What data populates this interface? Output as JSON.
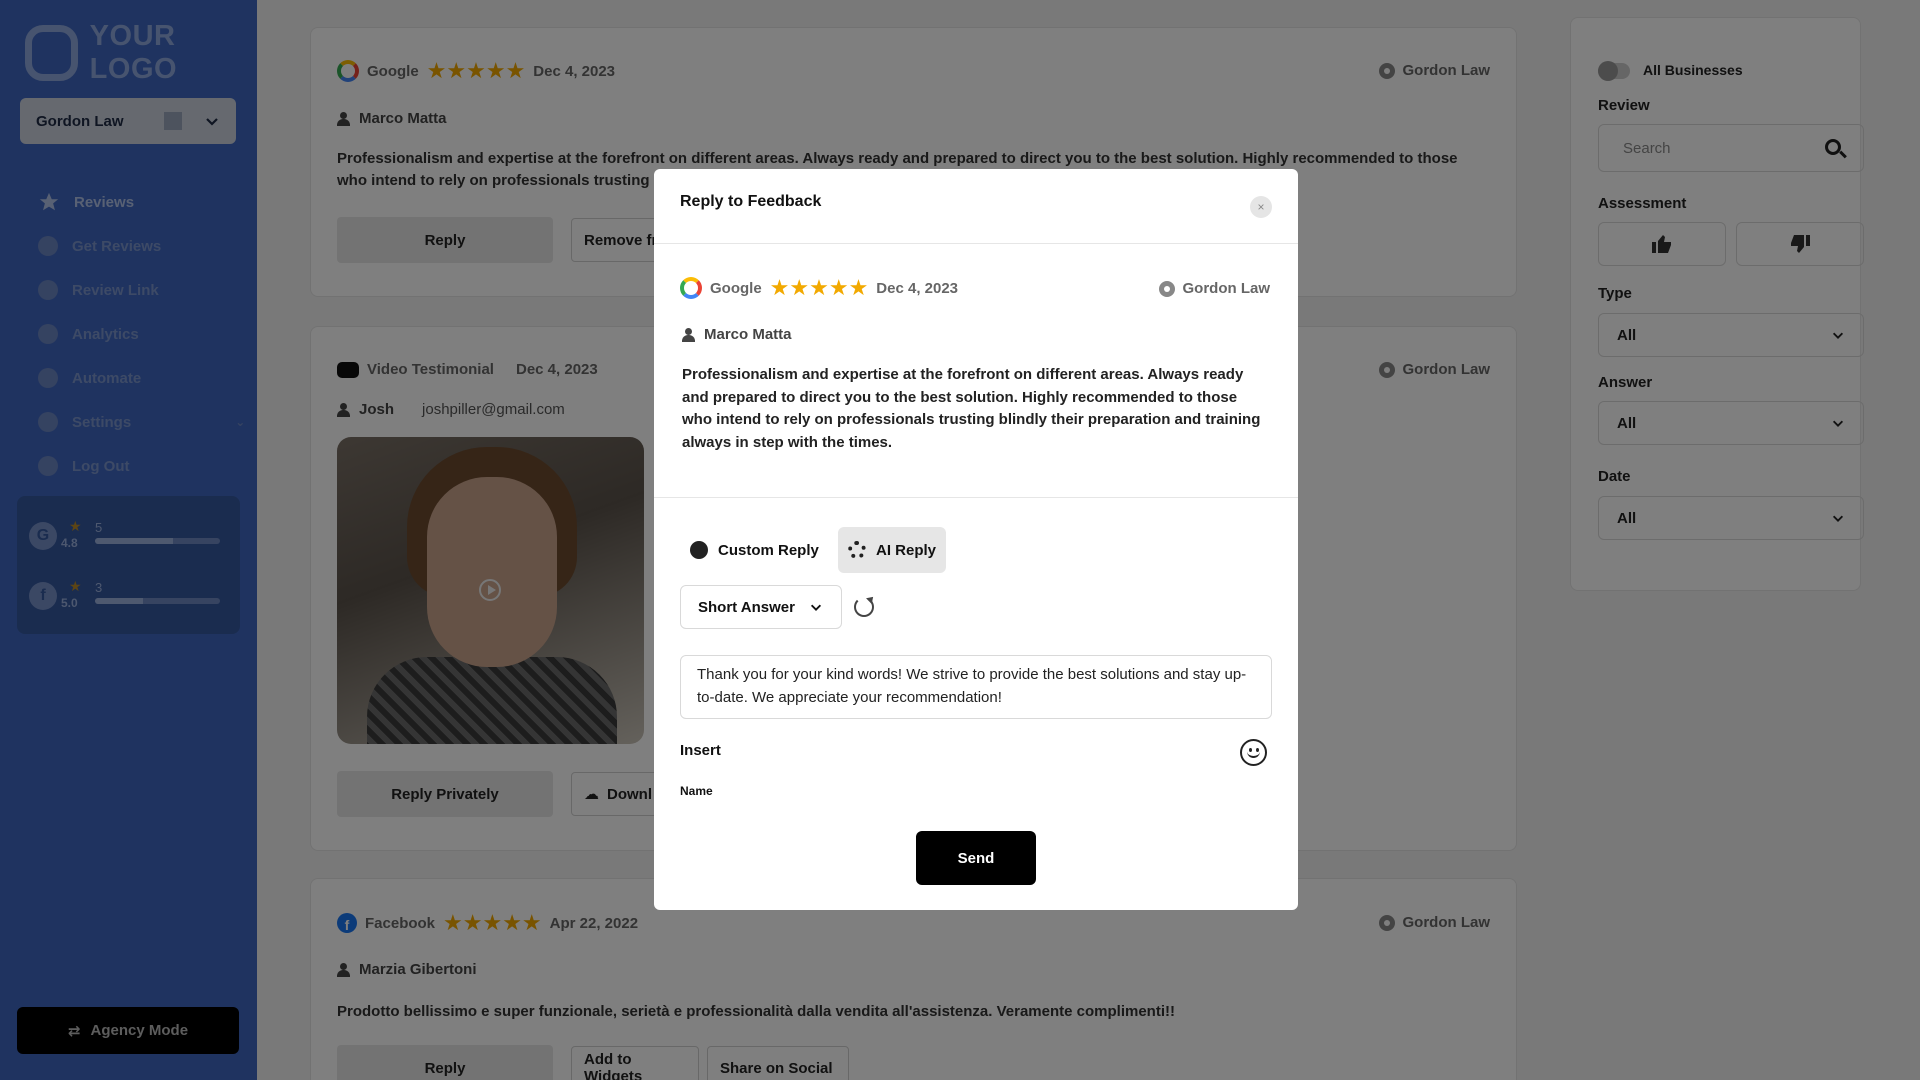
{
  "sidebar": {
    "logo_text": "YOUR LOGO",
    "business": "Gordon Law",
    "nav": [
      {
        "label": "Reviews",
        "icon": "star-icon"
      },
      {
        "label": "Get Reviews",
        "icon": "plus-icon"
      },
      {
        "label": "Review Link",
        "icon": "link-icon"
      },
      {
        "label": "Analytics",
        "icon": "chart-icon"
      },
      {
        "label": "Automate",
        "icon": "automate-icon"
      },
      {
        "label": "Settings",
        "icon": "gear-icon"
      },
      {
        "label": "Log Out",
        "icon": "logout-icon"
      }
    ],
    "ratings": [
      {
        "source": "Google",
        "score": "4.8",
        "count": "5",
        "fill": 0.62
      },
      {
        "source": "Facebook",
        "score": "5.0",
        "count": "3",
        "fill": 0.38
      }
    ],
    "agency_mode": "Agency Mode"
  },
  "reviews": [
    {
      "source": "Google",
      "date": "Dec 4, 2023",
      "stars": 5,
      "location": "Gordon Law",
      "author": "Marco Matta",
      "text": "Professionalism and expertise at the forefront on different areas. Always ready and prepared to direct you to the best solution. Highly recommended to those who intend to rely on professionals trusting blindly t",
      "buttons": [
        "Reply",
        "Remove fr"
      ]
    },
    {
      "source": "Video Testimonial",
      "date": "Dec 4, 2023",
      "location": "Gordon Law",
      "author": "Josh",
      "email": "joshpiller@gmail.com",
      "buttons": [
        "Reply Privately",
        "Downl"
      ]
    },
    {
      "source": "Facebook",
      "date": "Apr 22, 2022",
      "stars": 5,
      "location": "Gordon Law",
      "author": "Marzia Gibertoni",
      "text": "Prodotto bellissimo e super funzionale, serietà e professionalità dalla vendita all'assistenza. Veramente complimenti!!",
      "buttons": [
        "Reply",
        "Add to Widgets",
        "Share on Social"
      ]
    }
  ],
  "filters": {
    "all_businesses": "All Businesses",
    "review_label": "Review",
    "search_placeholder": "Search",
    "assessment_label": "Assessment",
    "type_label": "Type",
    "type_value": "All",
    "answer_label": "Answer",
    "answer_value": "All",
    "date_label": "Date",
    "date_value": "All"
  },
  "modal": {
    "title": "Reply to Feedback",
    "close": "×",
    "source": "Google",
    "date": "Dec 4, 2023",
    "location": "Gordon Law",
    "author": "Marco Matta",
    "text": "Professionalism and expertise at the forefront on different areas. Always ready and prepared to direct you to the best solution. Highly recommended to those who intend to rely on professionals trusting blindly their preparation and training always in step with the times.",
    "tab_custom": "Custom Reply",
    "tab_ai": "AI Reply",
    "answer_length": "Short Answer",
    "reply_text": "Thank you for your kind words! We strive to provide the best solutions and stay up-to-date. We appreciate your recommendation!",
    "insert_label": "Insert",
    "name_label": "Name",
    "send": "Send"
  }
}
